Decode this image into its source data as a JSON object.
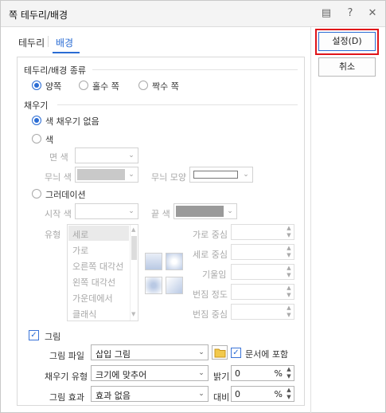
{
  "window": {
    "title": "쪽 테두리/배경",
    "help_icon": "question-icon",
    "menu_icon": "list-icon",
    "close_icon": "close-icon"
  },
  "tabs": [
    {
      "label": "테두리"
    },
    {
      "label": "배경"
    }
  ],
  "buttons": {
    "ok": "설정(D)",
    "cancel": "취소"
  },
  "sections": {
    "kind": {
      "title": "테두리/배경 종류",
      "options": [
        {
          "label": "양쪽",
          "selected": true
        },
        {
          "label": "홀수 쪽",
          "selected": false
        },
        {
          "label": "짝수 쪽",
          "selected": false
        }
      ]
    },
    "fill": {
      "title": "채우기",
      "no_fill": "색 채우기 없음",
      "color": {
        "label": "색",
        "face_color": "면 색",
        "pattern_color": "무늬 색",
        "pattern_shape": "무늬 모양"
      },
      "gradient": {
        "label": "그러데이션",
        "start_color": "시작 색",
        "end_color": "끝 색",
        "type_label": "유형",
        "types": [
          "세로",
          "가로",
          "오른쪽 대각선",
          "왼쪽 대각선",
          "가운데에서",
          "클래식"
        ],
        "selected_type": "세로",
        "h_center": "가로 중심",
        "v_center": "세로 중심",
        "tilt": "기울임",
        "blur": "번짐 정도",
        "blur_center": "번짐 중심"
      },
      "picture": {
        "label": "그림",
        "checked": true,
        "file_label": "그림 파일",
        "file_value": "삽입 그림",
        "embed_label": "문서에 포함",
        "embed_checked": true,
        "fill_type_label": "채우기 유형",
        "fill_type_value": "크기에 맞추어",
        "brightness_label": "밝기",
        "brightness_value": "0",
        "effect_label": "그림 효과",
        "effect_value": "효과 없음",
        "contrast_label": "대비",
        "contrast_value": "0",
        "percent": "%"
      }
    }
  },
  "colors": {
    "accent": "#2a6cd4",
    "highlight": "#e0141a"
  }
}
